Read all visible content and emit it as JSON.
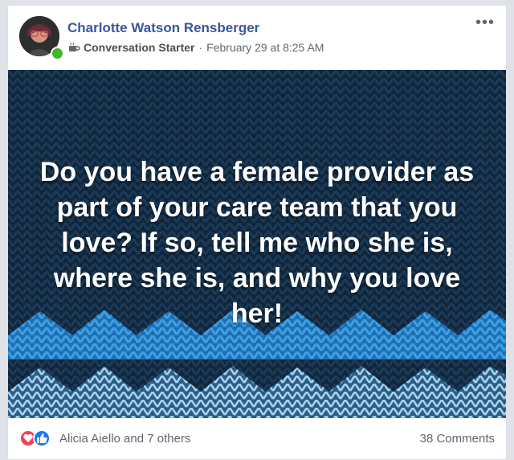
{
  "post": {
    "author": "Charlotte Watson Rensberger",
    "badge": "Conversation Starter",
    "separator": "·",
    "timestamp": "February 29 at 8:25 AM",
    "more_label": "•••",
    "message": "Do you have a female provider as part of your care team that you love? If so, tell me who she is, where she is, and why you love her!",
    "reactions_text": "Alicia Aiello and 7 others",
    "comments_text": "38 Comments"
  },
  "icons": {
    "badge": "coffee-cup-icon",
    "reactions": [
      "love-icon",
      "like-icon"
    ]
  },
  "colors": {
    "author": "#385898",
    "presence": "#42b72a",
    "love": "#f33e58",
    "like": "#1877f2",
    "hero_bg": "#0d2236"
  }
}
